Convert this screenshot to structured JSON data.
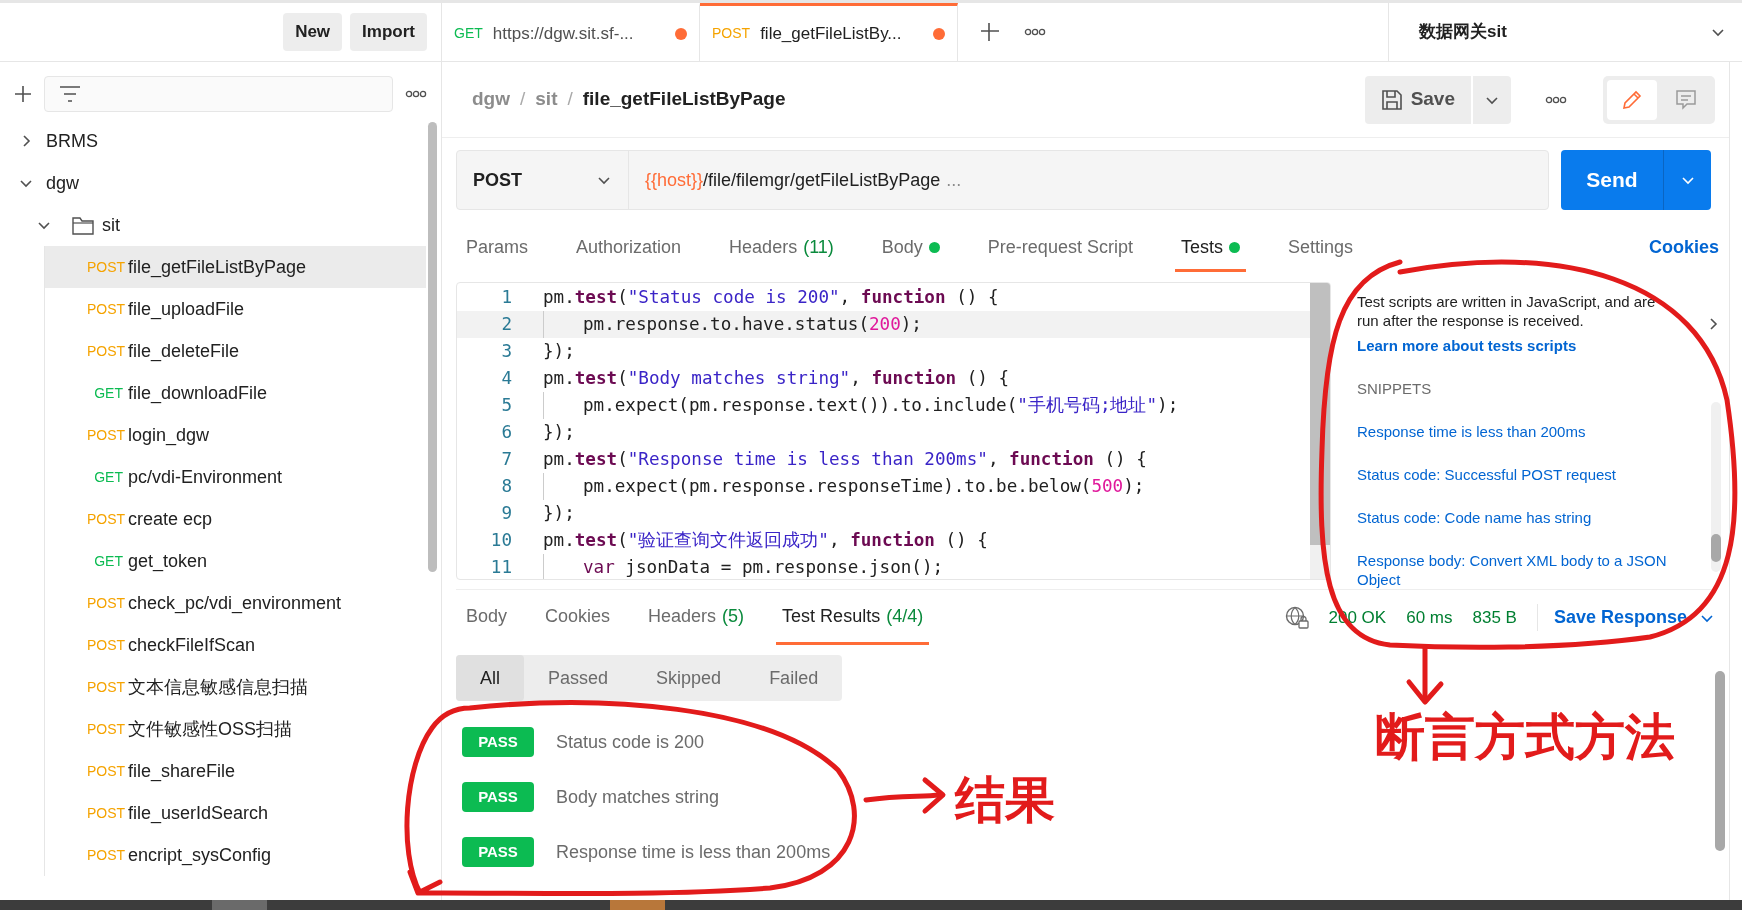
{
  "sidebar": {
    "buttons": [
      "New",
      "Import"
    ],
    "tree": [
      {
        "label": "BRMS",
        "expanded": false
      },
      {
        "label": "dgw",
        "expanded": true,
        "children": [
          {
            "label": "sit",
            "kind": "folder",
            "expanded": true,
            "children": [
              {
                "method": "POST",
                "label": "file_getFileListByPage",
                "selected": true
              },
              {
                "method": "POST",
                "label": "file_uploadFile",
                "selected": false
              },
              {
                "method": "POST",
                "label": "file_deleteFile",
                "selected": false
              },
              {
                "method": "GET",
                "label": "file_downloadFile",
                "selected": false
              },
              {
                "method": "POST",
                "label": "login_dgw",
                "selected": false
              },
              {
                "method": "GET",
                "label": "pc/vdi-Environment",
                "selected": false
              },
              {
                "method": "POST",
                "label": "create ecp",
                "selected": false
              },
              {
                "method": "GET",
                "label": "get_token",
                "selected": false
              },
              {
                "method": "POST",
                "label": "check_pc/vdi_environment",
                "selected": false
              },
              {
                "method": "POST",
                "label": "checkFileIfScan",
                "selected": false
              },
              {
                "method": "POST",
                "label": "文本信息敏感信息扫描",
                "selected": false
              },
              {
                "method": "POST",
                "label": "文件敏感性OSS扫描",
                "selected": false
              },
              {
                "method": "POST",
                "label": "file_shareFile",
                "selected": false
              },
              {
                "method": "POST",
                "label": "file_userIdSearch",
                "selected": false
              },
              {
                "method": "POST",
                "label": "encript_sysConfig",
                "selected": false
              }
            ]
          }
        ]
      }
    ]
  },
  "open_tabs": [
    {
      "method": "GET",
      "label": "https://dgw.sit.sf-...",
      "unsaved": true,
      "selected": false
    },
    {
      "method": "POST",
      "label": "file_getFileListBy...",
      "unsaved": true,
      "selected": true
    }
  ],
  "environment": "数据网关sit",
  "breadcrumb": [
    {
      "label": "dgw",
      "separator": "/"
    },
    {
      "label": "sit",
      "separator": "/"
    },
    {
      "label": "file_getFileListByPage"
    }
  ],
  "save_button": "Save",
  "view_toggle": [
    {
      "kind": "edit",
      "selected": true
    },
    {
      "kind": "comments",
      "selected": false
    }
  ],
  "request": {
    "method": "POST",
    "url_variable": "{{host}}",
    "url_path": "/file/filemgr/getFileListByPage",
    "url_more": "...",
    "send": "Send"
  },
  "request_tabs": [
    {
      "label": "Params",
      "selected": false
    },
    {
      "label": "Authorization",
      "selected": false
    },
    {
      "label": "Headers",
      "count": "(11)",
      "selected": false
    },
    {
      "label": "Body",
      "dot": true,
      "selected": false
    },
    {
      "label": "Pre-request Script",
      "selected": false
    },
    {
      "label": "Tests",
      "dot": true,
      "selected": true
    },
    {
      "label": "Settings",
      "selected": false
    }
  ],
  "cookies_link": "Cookies",
  "editor": {
    "lines": [
      {
        "number": "1",
        "code": "pm.test(\"Status code is 200\", function () {",
        "active": false
      },
      {
        "number": "2",
        "code": "    pm.response.to.have.status(200);",
        "active": true
      },
      {
        "number": "3",
        "code": "});",
        "active": false
      },
      {
        "number": "4",
        "code": "pm.test(\"Body matches string\", function () {",
        "active": false
      },
      {
        "number": "5",
        "code": "    pm.expect(pm.response.text()).to.include(\"手机号码;地址\");",
        "active": false
      },
      {
        "number": "6",
        "code": "});",
        "active": false
      },
      {
        "number": "7",
        "code": "pm.test(\"Response time is less than 200ms\", function () {",
        "active": false
      },
      {
        "number": "8",
        "code": "    pm.expect(pm.response.responseTime).to.be.below(500);",
        "active": false
      },
      {
        "number": "9",
        "code": "});",
        "active": false
      },
      {
        "number": "10",
        "code": "pm.test(\"验证查询文件返回成功\", function () {",
        "active": false
      },
      {
        "number": "11",
        "code": "    var jsonData = pm.response.json();",
        "active": false
      }
    ]
  },
  "help_panel": {
    "description": "Test scripts are written in JavaScript, and are run after the response is received.",
    "link": "Learn more about tests scripts",
    "snippets_heading": "SNIPPETS",
    "snippets": [
      "Response time is less than 200ms",
      "Status code: Successful POST request",
      "Status code: Code name has string",
      "Response body: Convert XML body to a JSON Object"
    ]
  },
  "response_tabs": [
    {
      "label": "Body",
      "selected": false
    },
    {
      "label": "Cookies",
      "selected": false
    },
    {
      "label": "Headers",
      "count": "(5)",
      "selected": false
    },
    {
      "label": "Test Results",
      "count": "(4/4)",
      "selected": true
    }
  ],
  "response_status": {
    "status": "200 OK",
    "time": "60 ms",
    "size": "835 B",
    "save": "Save Response"
  },
  "result_filters": [
    {
      "label": "All",
      "selected": true
    },
    {
      "label": "Passed",
      "selected": false
    },
    {
      "label": "Skipped",
      "selected": false
    },
    {
      "label": "Failed",
      "selected": false
    }
  ],
  "test_results": [
    {
      "status": "PASS",
      "name": "Status code is 200"
    },
    {
      "status": "PASS",
      "name": "Body matches string"
    },
    {
      "status": "PASS",
      "name": "Response time is less than 200ms"
    }
  ],
  "annotations": [
    {
      "text": "断言方式方法"
    },
    {
      "text": "结果"
    }
  ]
}
